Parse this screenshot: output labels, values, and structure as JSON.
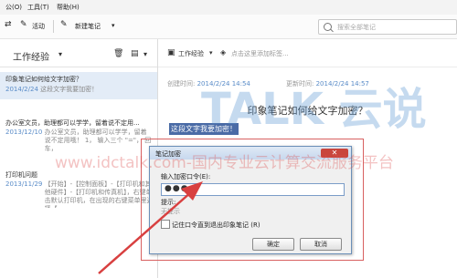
{
  "menu": [
    "公(O)",
    "工具(T)",
    "帮助(H)"
  ],
  "toolbar": {
    "sync": "活动",
    "new_note": "新建笔记",
    "search_placeholder": "搜索全部笔记"
  },
  "notebook": {
    "title": "工作经验"
  },
  "notes": [
    {
      "title": "印象笔记如何给文字加密？",
      "date": "2014/2/24",
      "snippet": "这段文字我要加密！"
    },
    {
      "title": "办公室文员，助理都可以学学，留着说不定用...",
      "date": "2013/12/10",
      "snippet": "办公室文员，助理都可以学学，留着说不定用哦！ 1， 输入三个 \"=\"， 回车，"
    },
    {
      "title": "打印机问题",
      "date": "2013/11/29",
      "snippet": "【开始】-【控制面板】-【打印机和其他硬件】-【打印机和传真机】，右键单击默认打印机，在出现的右键菜单里选择【..."
    }
  ],
  "right": {
    "notebook": "工作经验",
    "tag_placeholder": "点击这里添加标签...",
    "created_label": "创建时间:",
    "created": "2014/2/24 14:54",
    "updated_label": "更新时间:",
    "updated": "2014/2/24 14:57",
    "doc_title": "印象笔记如何给文字加密？",
    "selected_text": "这段文字我要加密！"
  },
  "dialog": {
    "title": "笔记加密",
    "prompt": "输入加密口令(E):",
    "password": "●●●",
    "hint_label": "提示:",
    "hint_value": "无提示",
    "remember": "记住口令直到退出印象笔记 (R)",
    "ok": "确定",
    "cancel": "取消"
  },
  "watermark": {
    "brand": "TALK 云说",
    "url": "www.idctalk.com-国内专业云计算交流服务平台"
  },
  "colors": {
    "accent": "#4a6ba6",
    "arrow": "#d84040",
    "highlight": "#d86060"
  }
}
